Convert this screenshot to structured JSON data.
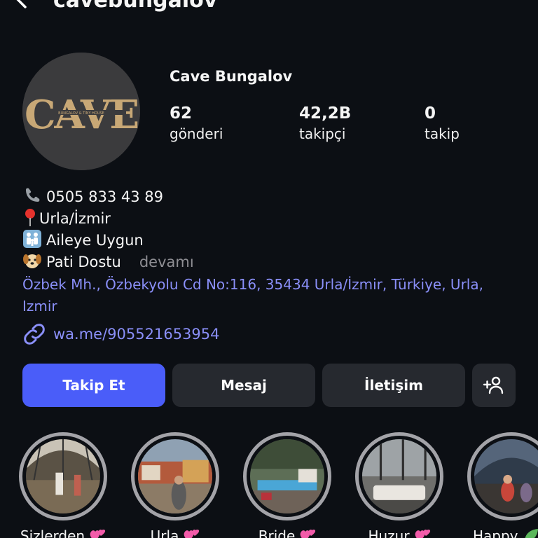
{
  "header": {
    "username": "cavebungalov",
    "back_icon": "chevron-left-icon",
    "more_icon": "more-horizontal-icon"
  },
  "profile": {
    "display_name": "Cave Bungalov",
    "avatar_text": "CAVE",
    "avatar_subtext": "BUNGALOV & TINY HOUSE",
    "stats": [
      {
        "value": "62",
        "label": "gönderi"
      },
      {
        "value": "42,2B",
        "label": "takipçi"
      },
      {
        "value": "0",
        "label": "takip"
      }
    ]
  },
  "bio": {
    "lines": [
      {
        "emoji": "phone-icon",
        "text": "0505 833 43 89"
      },
      {
        "emoji": "pin-icon",
        "text": "Urla/İzmir"
      },
      {
        "emoji": "family-icon",
        "text": "Aileye Uygun"
      },
      {
        "emoji": "dog-icon",
        "text": "Pati Dostu"
      }
    ],
    "more_label": "devamı",
    "address": "Özbek Mh., Özbekyolu Cd No:116, 35434 Urla/İzmir, Türkiye, Urla, Izmir",
    "link": "wa.me/905521653954"
  },
  "actions": {
    "follow": "Takip Et",
    "message": "Mesaj",
    "contact": "İletişim",
    "suggest_icon": "add-person-icon"
  },
  "highlights": [
    {
      "label": "Sizlerden"
    },
    {
      "label": "Urla"
    },
    {
      "label": "Bride"
    },
    {
      "label": "Huzur"
    },
    {
      "label": "Happy"
    }
  ],
  "colors": {
    "background": "#0c0f14",
    "accent": "#4a5df9",
    "link": "#8a8ff8",
    "button": "#26292f",
    "logo_gold": "#c8a876"
  }
}
